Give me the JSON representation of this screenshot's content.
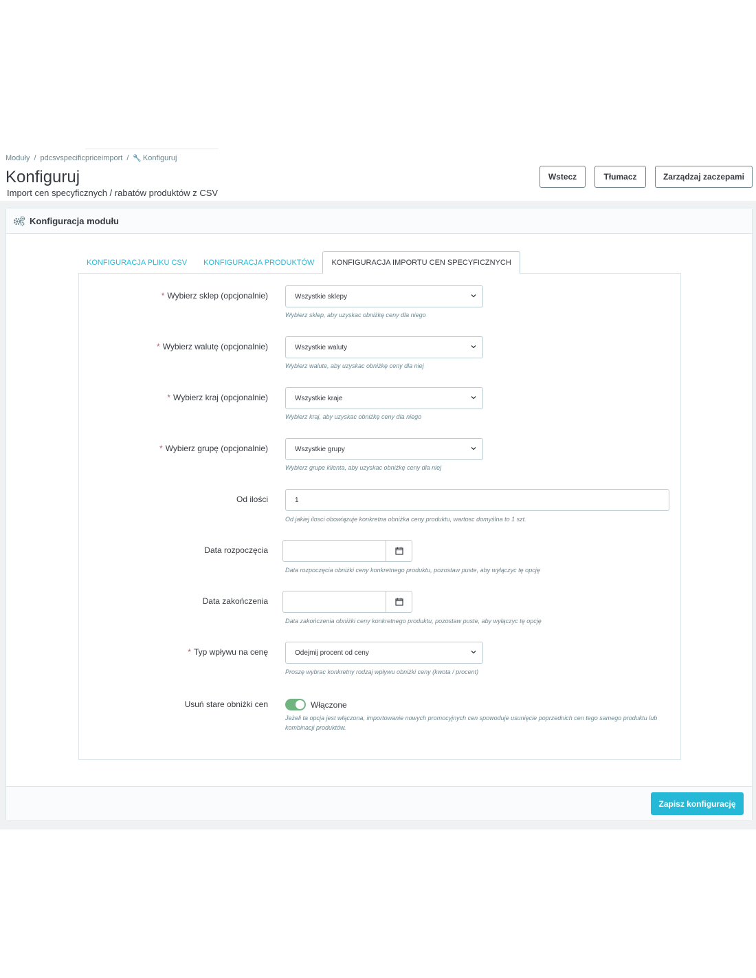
{
  "breadcrumb": {
    "items": [
      "Moduły",
      "pdcsvspecificpriceimport",
      "Konfiguruj"
    ],
    "separator": "/"
  },
  "header": {
    "title": "Konfiguruj",
    "subtitle": "Import cen specyficznych / rabatów produktów z CSV",
    "buttons": {
      "back": "Wstecz",
      "translate": "Tłumacz",
      "manage_hooks": "Zarządzaj zaczepami"
    }
  },
  "panel": {
    "title": "Konfiguracja modułu",
    "icon": "gears-icon"
  },
  "tabs": [
    {
      "label": "KONFIGURACJA PLIKU CSV",
      "active": false
    },
    {
      "label": "KONFIGURACJA PRODUKTÓW",
      "active": false
    },
    {
      "label": "KONFIGURACJA IMPORTU CEN SPECYFICZNYCH",
      "active": true
    }
  ],
  "form": {
    "shop": {
      "required_mark": "*",
      "label": "Wybierz sklep (opcjonalnie)",
      "value": "Wszystkie sklepy",
      "help": "Wybierz sklep, aby uzyskac obniżkę ceny dla niego"
    },
    "currency": {
      "required_mark": "*",
      "label": "Wybierz walutę (opcjonalnie)",
      "value": "Wszystkie waluty",
      "help": "Wybierz walute, aby uzyskac obniżkę ceny dla niej"
    },
    "country": {
      "required_mark": "*",
      "label": "Wybierz kraj (opcjonalnie)",
      "value": "Wszystkie kraje",
      "help": "Wybierz kraj, aby uzyskac obniżkę ceny dla niego"
    },
    "group": {
      "required_mark": "*",
      "label": "Wybierz grupę (opcjonalnie)",
      "value": "Wszystkie grupy",
      "help": "Wybierz grupe klienta, aby uzyskac obniżkę ceny dla niej"
    },
    "quantity": {
      "label": "Od ilości",
      "value": "1",
      "help": "Od jakiej ilosci obowiązuje konkretna obniżka ceny produktu, wartosc domyślna to 1 szt."
    },
    "date_from": {
      "label": "Data rozpoczęcia",
      "value": "",
      "help": "Data rozpoczęcia obniżki ceny konkretnego produktu, pozostaw puste, aby wyłączyc tę opcję"
    },
    "date_to": {
      "label": "Data zakończenia",
      "value": "",
      "help": "Data zakończenia obniżki ceny konkretnego produktu, pozostaw puste, aby wyłączyc tę opcję"
    },
    "reduction_type": {
      "required_mark": "*",
      "label": "Typ wpływu na cenę",
      "value": "Odejmij procent od ceny",
      "help": "Proszę wybrac konkretny rodzaj wpływu obniżki ceny (kwota / procent)"
    },
    "delete_old": {
      "label": "Usuń stare obniżki cen",
      "enabled": true,
      "state_label": "Włączone",
      "help": "Jeżeli ta opcja jest włączona, importowanie nowych promocyjnych cen spowoduje usunięcie poprzednich cen tego samego produktu lub kombinacji produktów."
    }
  },
  "footer": {
    "save_label": "Zapisz konfigurację"
  },
  "colors": {
    "accent": "#25b9d7",
    "required": "#c05c67",
    "switch_on": "#70b580",
    "text": "#363a41",
    "muted": "#6c868e"
  }
}
